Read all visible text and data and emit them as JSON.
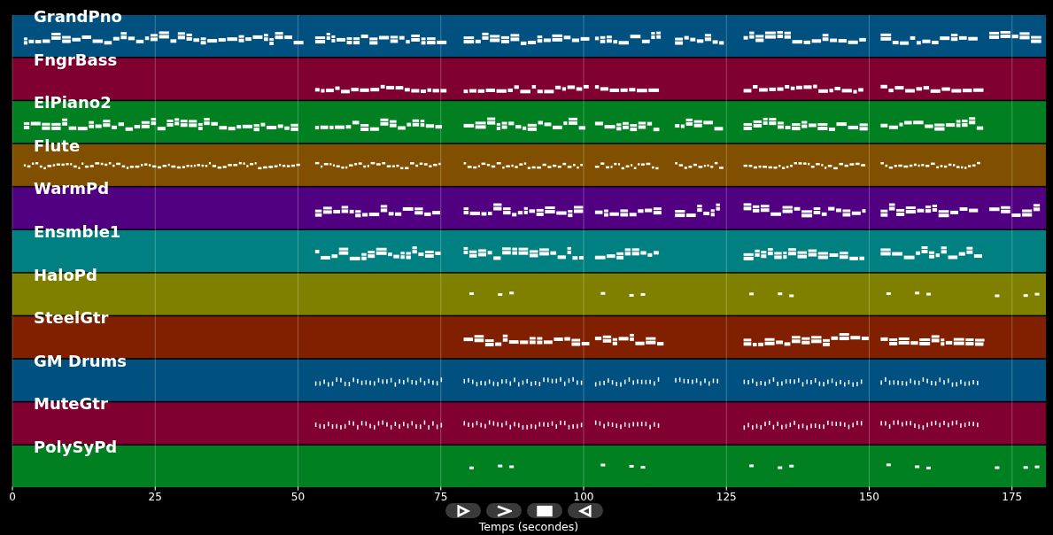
{
  "tracks": [
    {
      "name": "GrandPno",
      "color": "#005080"
    },
    {
      "name": "FngrBass",
      "color": "#800030"
    },
    {
      "name": "ElPiano2",
      "color": "#008020"
    },
    {
      "name": "Flute",
      "color": "#805000"
    },
    {
      "name": "WarmPd",
      "color": "#500080"
    },
    {
      "name": "Ensmble1",
      "color": "#008080"
    },
    {
      "name": "HaloPd",
      "color": "#808000"
    },
    {
      "name": "SteelGtr",
      "color": "#802000"
    },
    {
      "name": "GM Drums",
      "color": "#005080"
    },
    {
      "name": "MuteGtr",
      "color": "#800030"
    },
    {
      "name": "PolySyPd",
      "color": "#008020"
    }
  ],
  "x_axis": {
    "ticks": [
      "0",
      "25",
      "50",
      "75",
      "100",
      "125",
      "150",
      "175"
    ],
    "label": "Temps (secondes)"
  },
  "controls": [
    {
      "kind": "play"
    },
    {
      "kind": "next"
    },
    {
      "kind": "stop"
    },
    {
      "kind": "reverse"
    }
  ]
}
